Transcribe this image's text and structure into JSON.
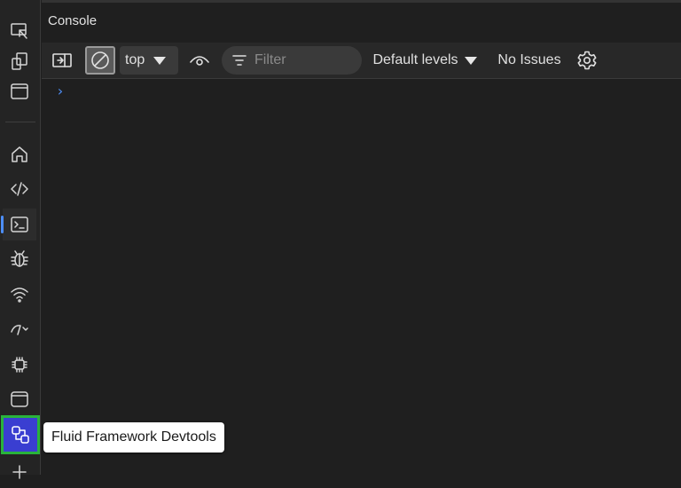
{
  "panel": {
    "title": "Console"
  },
  "toolbar": {
    "context_value": "top",
    "filter_placeholder": "Filter",
    "levels_label": "Default levels",
    "issues_label": "No Issues"
  },
  "console": {
    "prompt_symbol": "›"
  },
  "tooltip": {
    "text": "Fluid Framework Devtools"
  },
  "colors": {
    "accent": "#4d8ef7",
    "highlight_border": "#29b33c",
    "highlight_fill": "#3a3ed1"
  },
  "activity_icons": [
    "inspect-icon",
    "device-emulation-icon",
    "window-icon",
    "home-icon",
    "elements-icon",
    "console-icon",
    "sources-icon",
    "network-icon",
    "performance-icon",
    "memory-icon",
    "application-icon",
    "fluid-framework-devtools-icon",
    "add-icon"
  ]
}
